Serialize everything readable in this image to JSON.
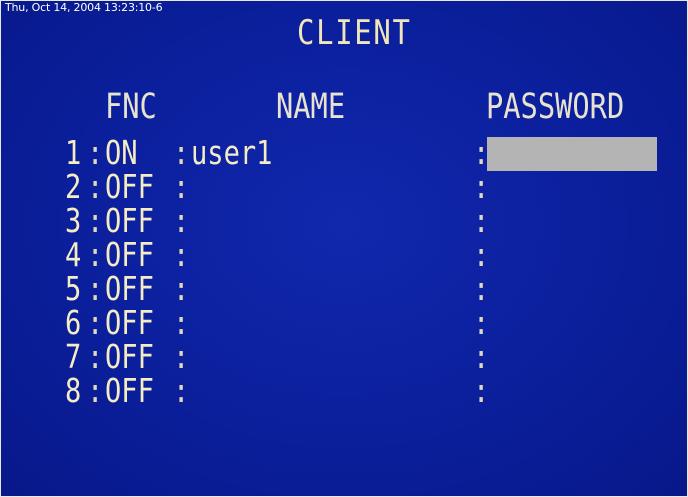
{
  "timestamp": "Thu, Oct 14, 2004 13:23:10-6",
  "title": "CLIENT",
  "headers": {
    "fnc": "FNC",
    "name": "NAME",
    "password": "PASSWORD"
  },
  "separator": ":",
  "rows": [
    {
      "num": "1",
      "fnc": "ON",
      "name": "user1",
      "password": "",
      "selected": true
    },
    {
      "num": "2",
      "fnc": "OFF",
      "name": "",
      "password": ""
    },
    {
      "num": "3",
      "fnc": "OFF",
      "name": "",
      "password": ""
    },
    {
      "num": "4",
      "fnc": "OFF",
      "name": "",
      "password": ""
    },
    {
      "num": "5",
      "fnc": "OFF",
      "name": "",
      "password": ""
    },
    {
      "num": "6",
      "fnc": "OFF",
      "name": "",
      "password": ""
    },
    {
      "num": "7",
      "fnc": "OFF",
      "name": "",
      "password": ""
    },
    {
      "num": "8",
      "fnc": "OFF",
      "name": "",
      "password": ""
    }
  ],
  "colors": {
    "background": "#0b1f9c",
    "text": "#f4ecc2",
    "highlight": "#b4b4b4"
  }
}
